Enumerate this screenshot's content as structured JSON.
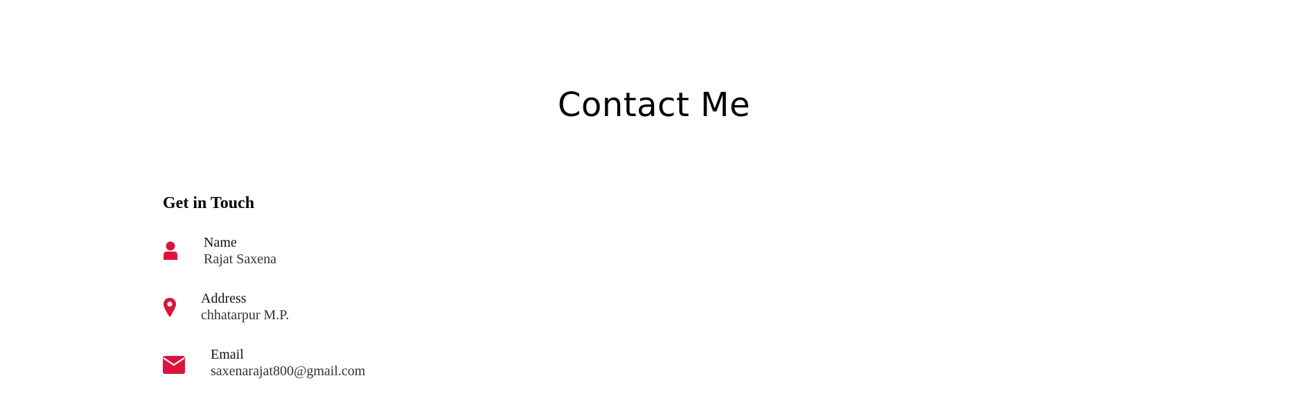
{
  "section": {
    "title": "Contact Me",
    "subtitle": "Get in Touch"
  },
  "contacts": [
    {
      "icon": "user-icon",
      "label": "Name",
      "value": "Rajat Saxena"
    },
    {
      "icon": "map-marker-icon",
      "label": "Address",
      "value": "chhatarpur M.P."
    },
    {
      "icon": "envelope-icon",
      "label": "Email",
      "value": "saxenarajat800@gmail.com"
    }
  ],
  "colors": {
    "accent": "#dc143c",
    "text": "#111111"
  }
}
